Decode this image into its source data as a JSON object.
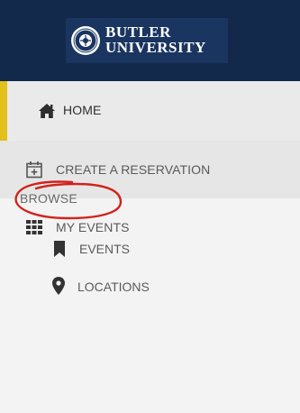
{
  "header": {
    "logo_line1": "BUTLER",
    "logo_line2": "UNIVERSITY",
    "bg_color": "#13294b"
  },
  "nav": {
    "items": [
      {
        "label": "HOME",
        "icon": "home-icon",
        "active": true
      },
      {
        "label": "CREATE A RESERVATION",
        "icon": "calendar-plus-icon"
      },
      {
        "label": "MY EVENTS",
        "icon": "grid-icon"
      }
    ],
    "active_accent": "#e3c11a"
  },
  "browse": {
    "title": "BROWSE",
    "annotation_color": "#d0231b",
    "items": [
      {
        "label": "EVENTS",
        "icon": "bookmark-icon"
      },
      {
        "label": "LOCATIONS",
        "icon": "map-pin-icon"
      }
    ]
  }
}
